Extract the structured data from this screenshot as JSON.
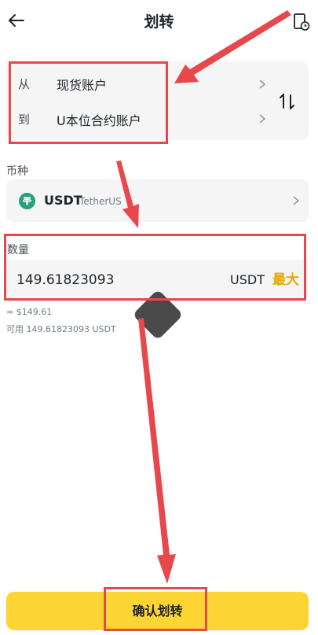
{
  "header": {
    "title": "划转"
  },
  "transfer": {
    "from_label": "从",
    "from_account": "现货账户",
    "to_label": "到",
    "to_account": "U本位合约账户"
  },
  "coin": {
    "section_label": "币种",
    "symbol": "USDT",
    "full_name": "TetherUS"
  },
  "amount": {
    "section_label": "数量",
    "value": "149.61823093",
    "unit": "USDT",
    "max_label": "最大",
    "usd_value": "≈ $149.61",
    "available": "可用 149.61823093 USDT"
  },
  "confirm_button": "确认划转",
  "colors": {
    "accent_yellow": "#fcd535",
    "max_text": "#e5a900",
    "annotation_red": "#e8474b",
    "usdt_green": "#26a17b"
  }
}
